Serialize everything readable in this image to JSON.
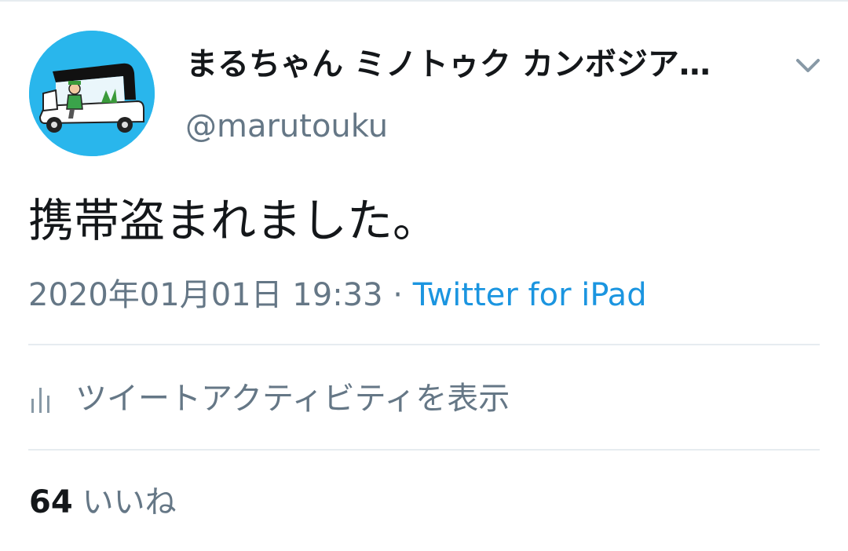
{
  "tweet": {
    "user": {
      "display_name": "まるちゃん ミノトゥク カンボジア…",
      "handle": "@marutouku",
      "avatar_icon": "tuktuk-driver-avatar"
    },
    "menu_icon": "chevron-down-icon",
    "text": "携帯盗まれました。",
    "timestamp": "2020年01月01日 19:33",
    "separator": " · ",
    "source": "Twitter for iPad",
    "activity": {
      "icon": "bar-chart-icon",
      "label": "ツイートアクティビティを表示"
    },
    "likes": {
      "count": "64",
      "label": "いいね"
    }
  },
  "colors": {
    "text_primary": "#14171a",
    "text_secondary": "#657786",
    "link": "#1b95e0",
    "avatar_bg": "#29b6ec",
    "divider": "#e6ecf0"
  }
}
